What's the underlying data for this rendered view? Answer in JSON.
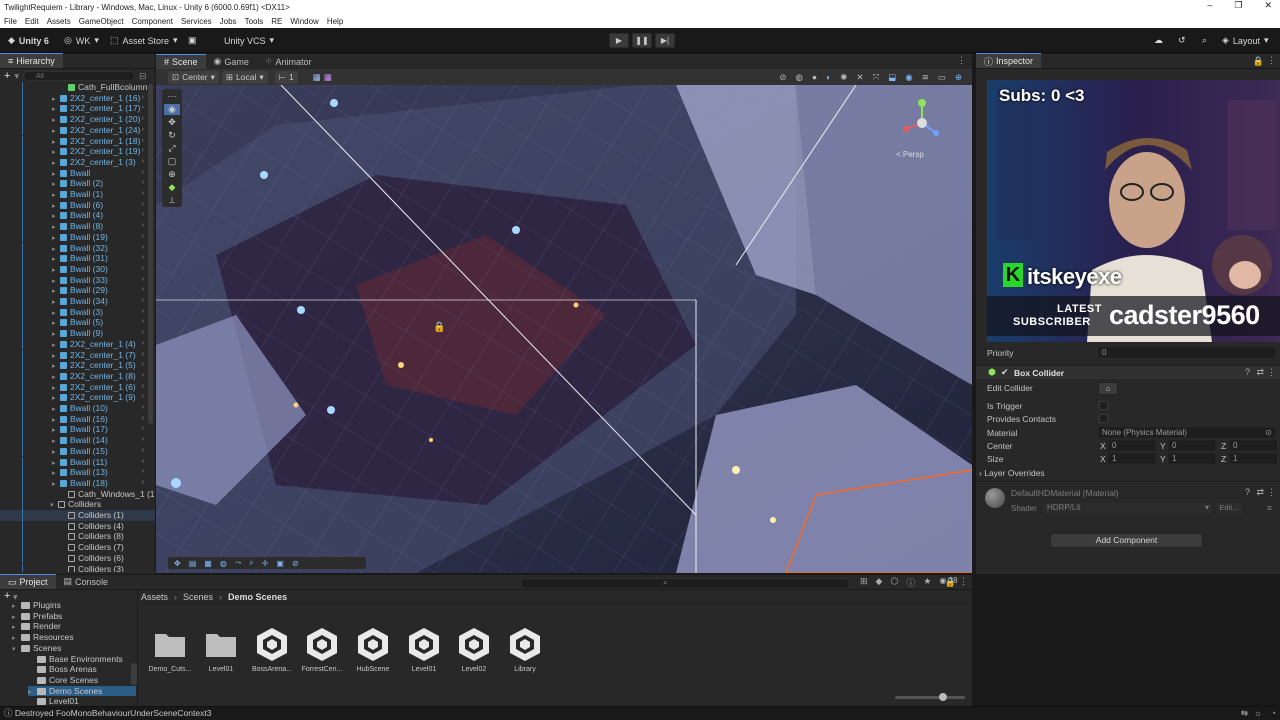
{
  "window": {
    "title": "TwilightRequiem - Library - Windows, Mac, Linux - Unity 6 (6000.0.69f1) <DX11>",
    "controls": [
      "–",
      "❐",
      "✕"
    ]
  },
  "menu": [
    "File",
    "Edit",
    "Assets",
    "GameObject",
    "Component",
    "Services",
    "Jobs",
    "Tools",
    "RE",
    "Window",
    "Help"
  ],
  "toolbar": {
    "unity_label": "Unity 6",
    "account_label": "WK",
    "asset_store_label": "Asset Store",
    "vcs_label": "Unity VCS",
    "layout_label": "Layout"
  },
  "hierarchy": {
    "tab": "Hierarchy",
    "search_placeholder": "All",
    "rows": [
      {
        "label": "Cath_FullBcolumn",
        "kind": "prefab"
      },
      {
        "label": "2X2_center_1 (16)",
        "kind": "blue"
      },
      {
        "label": "2X2_center_1 (17)",
        "kind": "blue"
      },
      {
        "label": "2X2_center_1 (20)",
        "kind": "blue"
      },
      {
        "label": "2X2_center_1 (24)",
        "kind": "blue"
      },
      {
        "label": "2X2_center_1 (18)",
        "kind": "blue"
      },
      {
        "label": "2X2_center_1 (19)",
        "kind": "blue"
      },
      {
        "label": "2X2_center_1 (3)",
        "kind": "blue"
      },
      {
        "label": "Bwall",
        "kind": "blue"
      },
      {
        "label": "Bwall (2)",
        "kind": "blue"
      },
      {
        "label": "Bwall (1)",
        "kind": "blue"
      },
      {
        "label": "Bwall (6)",
        "kind": "blue"
      },
      {
        "label": "Bwall (4)",
        "kind": "blue"
      },
      {
        "label": "Bwall (8)",
        "kind": "blue"
      },
      {
        "label": "Bwall (19)",
        "kind": "blue"
      },
      {
        "label": "Bwall (32)",
        "kind": "blue"
      },
      {
        "label": "Bwall (31)",
        "kind": "blue"
      },
      {
        "label": "Bwall (30)",
        "kind": "blue"
      },
      {
        "label": "Bwall (33)",
        "kind": "blue"
      },
      {
        "label": "Bwall (29)",
        "kind": "blue"
      },
      {
        "label": "Bwall (34)",
        "kind": "blue"
      },
      {
        "label": "Bwall (3)",
        "kind": "blue"
      },
      {
        "label": "Bwall (5)",
        "kind": "blue"
      },
      {
        "label": "Bwall (9)",
        "kind": "blue"
      },
      {
        "label": "2X2_center_1 (4)",
        "kind": "blue"
      },
      {
        "label": "2X2_center_1 (7)",
        "kind": "blue"
      },
      {
        "label": "2X2_center_1 (5)",
        "kind": "blue"
      },
      {
        "label": "2X2_center_1 (8)",
        "kind": "blue"
      },
      {
        "label": "2X2_center_1 (6)",
        "kind": "blue"
      },
      {
        "label": "2X2_center_1 (9)",
        "kind": "blue"
      },
      {
        "label": "Bwall (10)",
        "kind": "blue"
      },
      {
        "label": "Bwall (16)",
        "kind": "blue"
      },
      {
        "label": "Bwall (17)",
        "kind": "blue"
      },
      {
        "label": "Bwall (14)",
        "kind": "blue"
      },
      {
        "label": "Bwall (15)",
        "kind": "blue"
      },
      {
        "label": "Bwall (11)",
        "kind": "blue"
      },
      {
        "label": "Bwall (13)",
        "kind": "blue"
      },
      {
        "label": "Bwall (18)",
        "kind": "blue"
      },
      {
        "label": "Cath_Windows_1 (1)",
        "kind": "plain"
      },
      {
        "label": "Colliders",
        "kind": "plain"
      },
      {
        "label": "Colliders (1)",
        "kind": "plain"
      },
      {
        "label": "Colliders (4)",
        "kind": "plain"
      },
      {
        "label": "Colliders (8)",
        "kind": "plain"
      },
      {
        "label": "Colliders (7)",
        "kind": "plain"
      },
      {
        "label": "Colliders (6)",
        "kind": "plain"
      },
      {
        "label": "Colliders (3)",
        "kind": "plain"
      }
    ]
  },
  "scene": {
    "tabs": [
      "Scene",
      "Game",
      "Animator"
    ],
    "pivot_label": "Center",
    "space_label": "Local",
    "grid_value": "1",
    "persp_label": "< Persp"
  },
  "inspector": {
    "tab": "Inspector",
    "priority_label": "Priority",
    "priority_value": "0",
    "component_title": "Box Collider",
    "edit_collider": "Edit Collider",
    "is_trigger": "Is Trigger",
    "provides_contacts": "Provides Contacts",
    "material_label": "Material",
    "material_value": "None (Physics Material)",
    "center_label": "Center",
    "center": {
      "x": "0",
      "y": "0",
      "z": "0"
    },
    "size_label": "Size",
    "size": {
      "x": "1",
      "y": "1",
      "z": "1"
    },
    "layer_overrides": "Layer Overrides",
    "hd_material": "DefaultHDMaterial (Material)",
    "shader_label": "Shader",
    "shader_value": "HDRP/Lit",
    "edit_btn": "Edit...",
    "add_component": "Add Component",
    "axis_x": "X",
    "axis_y": "Y",
    "axis_z": "Z"
  },
  "overlay": {
    "subs": "Subs: 0 <3",
    "brand": "itskeyexe",
    "latest": "LATEST",
    "subscriber": "SUBSCRIBER",
    "name": "cadster9560"
  },
  "project": {
    "tabs": [
      "Project",
      "Console"
    ],
    "tree": [
      "Plugins",
      "Prefabs",
      "Render",
      "Resources",
      "Scenes",
      "Base Environments",
      "Boss Arenas",
      "Core Scenes",
      "Demo Scenes",
      "Level01"
    ],
    "breadcrumb": [
      "Assets",
      "Scenes",
      "Demo Scenes"
    ],
    "badge_count": "38",
    "assets": [
      {
        "label": "Demo_Cuts...",
        "type": "folder"
      },
      {
        "label": "Level01",
        "type": "folder"
      },
      {
        "label": "BossArena...",
        "type": "scene"
      },
      {
        "label": "ForrestCen...",
        "type": "scene"
      },
      {
        "label": "HubScene",
        "type": "scene"
      },
      {
        "label": "Level01",
        "type": "scene"
      },
      {
        "label": "Level02",
        "type": "scene"
      },
      {
        "label": "Library",
        "type": "scene"
      }
    ]
  },
  "status": {
    "message": "Destroyed FooMonoBehaviourUnderSceneContext3"
  },
  "colors": {
    "accent": "#4a8ee0",
    "prefab_blue": "#58a7d9",
    "overlay_green": "#2bd62b",
    "selection_orange": "#ff6a1f"
  }
}
